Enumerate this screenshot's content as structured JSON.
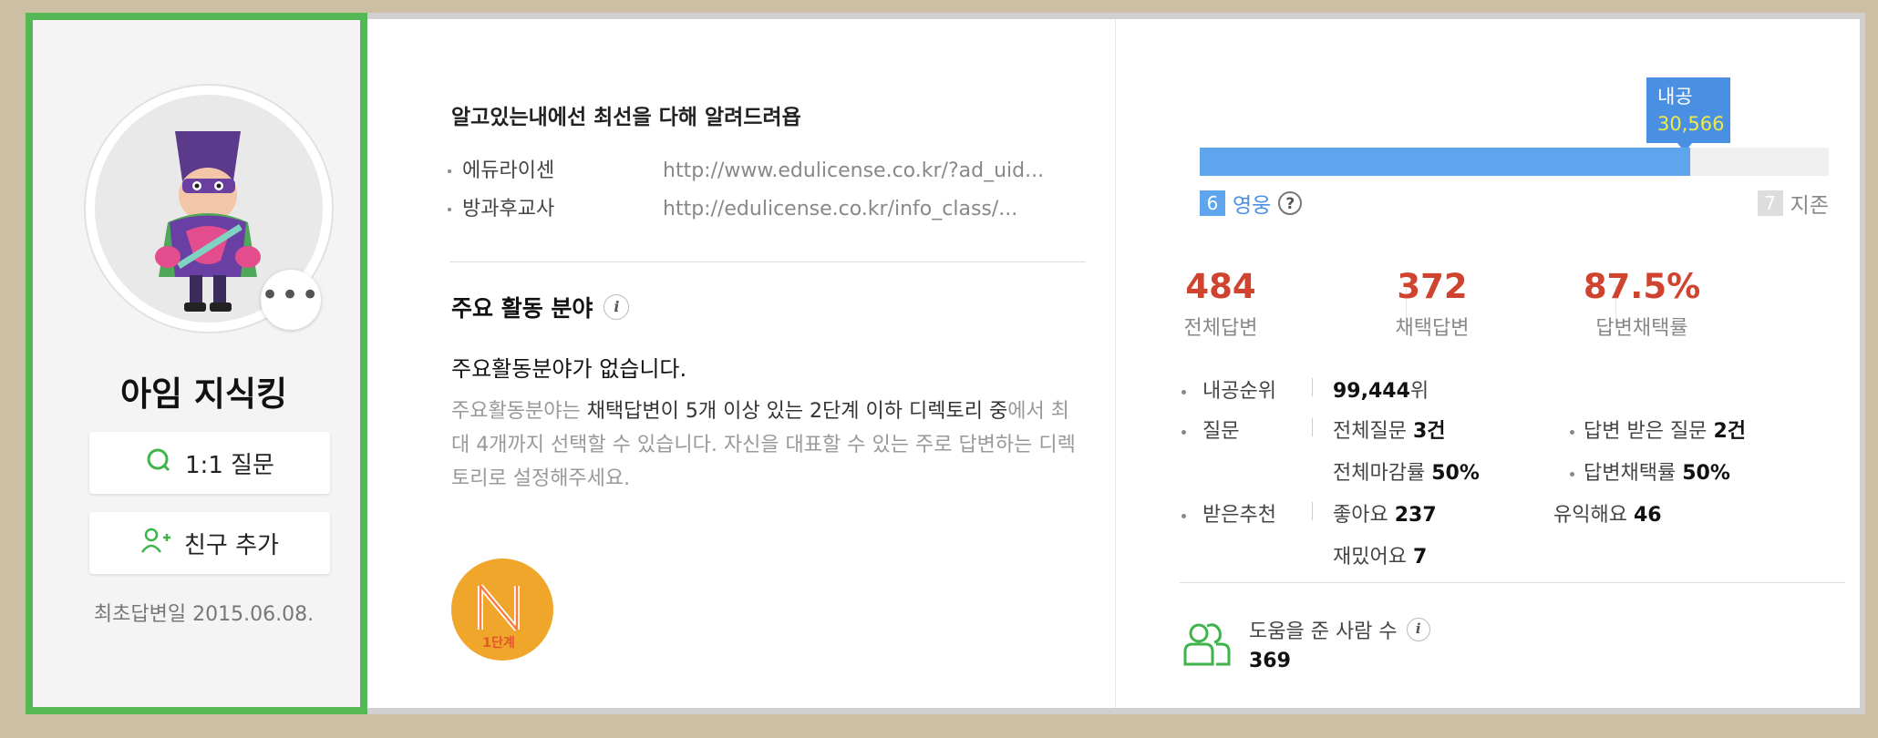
{
  "profile": {
    "nickname": "아임 지식킹",
    "question_button": "1:1 질문",
    "add_friend_button": "친구 추가",
    "first_answer_date": "최초답변일 2015.06.08."
  },
  "intro": {
    "text": "알고있는내에선 최선을 다해 알려드려욥",
    "links": [
      {
        "name": "에듀라이센",
        "url": "http://www.edulicense.co.kr/?ad_uid..."
      },
      {
        "name": "방과후교사",
        "url": "http://edulicense.co.kr/info_class/..."
      }
    ]
  },
  "activity": {
    "title": "주요 활동 분야",
    "none_text": "주요활동분야가 없습니다.",
    "desc_prefix": "주요활동분야는 ",
    "desc_bold": "채택답변이 5개 이상 있는 2단계 이하 디렉토리 중",
    "desc_rest": "에서 최대 4개까지 선택할 수 있습니다. 자신을 대표할 수 있는 주로 답변하는 디렉토리로 설정해주세요.",
    "badge_label": "1단계"
  },
  "level": {
    "tooltip_label": "내공",
    "tooltip_value": "30,566",
    "progress": 0.78,
    "current_num": "6",
    "current_name": "영웅",
    "next_num": "7",
    "next_name": "지존",
    "accent": "#5fa5ee"
  },
  "stats": [
    {
      "value": "484",
      "label": "전체답변"
    },
    {
      "value": "372",
      "label": "채택답변"
    },
    {
      "value": "87.5%",
      "label": "답변채택률"
    }
  ],
  "details": {
    "rank_label": "내공순위",
    "rank_value": "99,444",
    "rank_unit": "위",
    "question_label": "질문",
    "total_q_label": "전체질문",
    "total_q_value": "3건",
    "answered_q_label": "답변 받은 질문",
    "answered_q_value": "2건",
    "close_rate_label": "전체마감률",
    "close_rate_value": "50%",
    "adopt_rate_label": "답변채택률",
    "adopt_rate_value": "50%",
    "reco_label": "받은추천",
    "like_label": "좋아요",
    "like_value": "237",
    "useful_label": "유익해요",
    "useful_value": "46",
    "fun_label": "재밌어요",
    "fun_value": "7"
  },
  "helped": {
    "label": "도움을 준 사람 수",
    "value": "369"
  }
}
